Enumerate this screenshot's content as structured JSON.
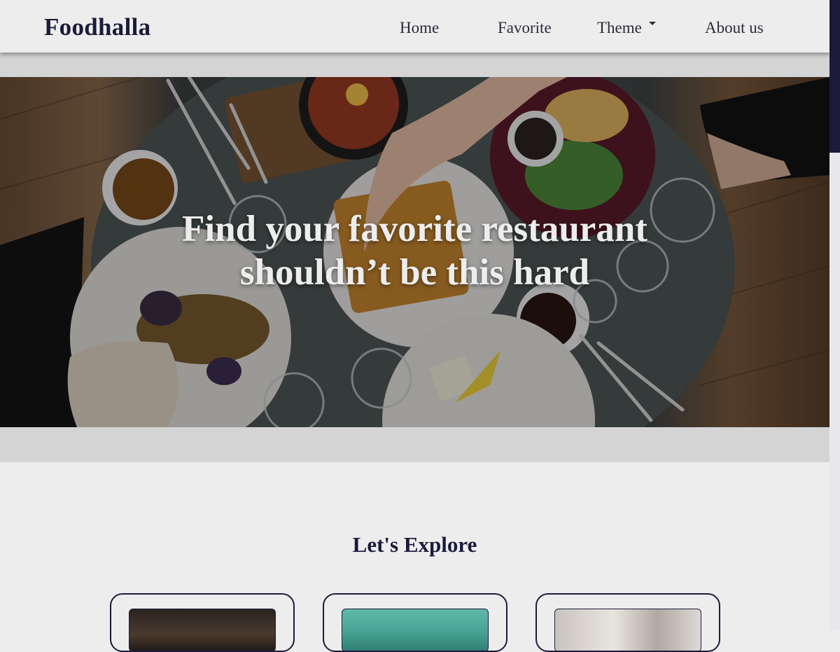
{
  "navbar": {
    "brand": "Foodhalla",
    "items": [
      {
        "label": "Home"
      },
      {
        "label": "Favorite"
      },
      {
        "label": "Theme"
      },
      {
        "label": "About us"
      }
    ]
  },
  "hero": {
    "title_line1": "Find your favorite restaurant",
    "title_line2": "shouldn’t be this hard",
    "image_icon": "food-table-photo"
  },
  "explore": {
    "title": "Let's Explore",
    "cards": [
      {
        "image_icon": "restaurant-interior-photo"
      },
      {
        "image_icon": "teal-storefront-photo"
      },
      {
        "image_icon": "cafe-people-photo"
      }
    ]
  },
  "colors": {
    "brand": "#1c1b3a",
    "background": "#ededee",
    "band": "#d4d4d5",
    "hero_text": "#ededed"
  }
}
